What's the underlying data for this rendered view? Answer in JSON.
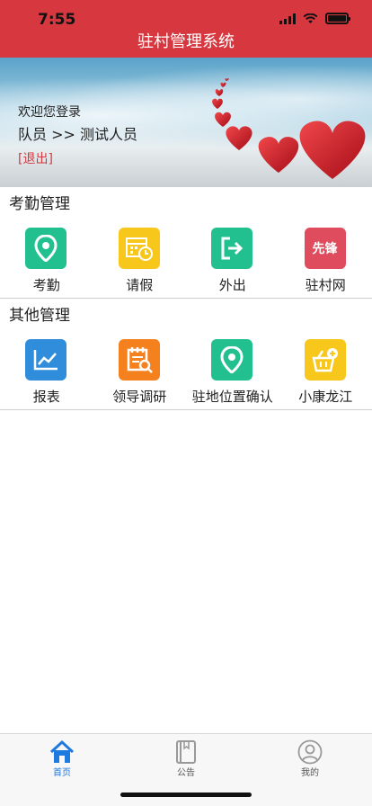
{
  "status_bar": {
    "time": "7:55"
  },
  "header": {
    "title": "驻村管理系统"
  },
  "banner": {
    "welcome": "欢迎您登录",
    "role": "队员",
    "separator": ">>",
    "user_name": "测试人员",
    "logout_label": "[退出]"
  },
  "sections": [
    {
      "title": "考勤管理",
      "items": [
        {
          "label": "考勤",
          "icon": "location-pin-icon",
          "color": "#22c08f"
        },
        {
          "label": "请假",
          "icon": "calendar-clock-icon",
          "color": "#f8c71c"
        },
        {
          "label": "外出",
          "icon": "exit-icon",
          "color": "#22c08f"
        },
        {
          "label": "驻村网",
          "icon_text": "先锋",
          "icon": "pioneer-logo-icon",
          "color": "#de4c5d"
        }
      ]
    },
    {
      "title": "其他管理",
      "items": [
        {
          "label": "报表",
          "icon": "line-chart-icon",
          "color": "#2f8ddc"
        },
        {
          "label": "领导调研",
          "icon": "survey-search-icon",
          "color": "#f5801e"
        },
        {
          "label": "驻地位置确认",
          "icon": "location-pin-icon",
          "color": "#22c08f"
        },
        {
          "label": "小康龙江",
          "icon": "basket-plus-icon",
          "color": "#f8c71c"
        }
      ]
    }
  ],
  "tabbar": {
    "items": [
      {
        "label": "首页",
        "icon": "home-icon",
        "active": true
      },
      {
        "label": "公告",
        "icon": "book-icon",
        "active": false
      },
      {
        "label": "我的",
        "icon": "user-icon",
        "active": false
      }
    ]
  },
  "colors": {
    "header_red": "#d7373e",
    "tab_active": "#1f7ae0"
  }
}
